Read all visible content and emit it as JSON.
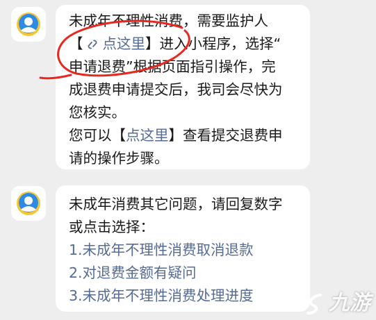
{
  "messages": [
    {
      "lines": {
        "l1": "未成年不理性消费，需要监护人",
        "l2_open": "【",
        "l2_link": "点这里",
        "l2_close": "】进入小程序，选择“",
        "l3": "申请退费”根据页面指引操作，完",
        "l4": "成退费申请提交后，我司会尽快为",
        "l5": "您核实。",
        "l6_before": "您可以【",
        "l6_link": "点这里",
        "l6_after": "】查看提交退费申",
        "l7": "请的操作步骤。"
      }
    },
    {
      "lines": {
        "l1": "未成年消费其它问题，请回复数字",
        "l2": "或点击选择："
      },
      "options": [
        "1.未成年不理性消费取消退款",
        "2.对退费金额有疑问",
        "3.未成年不理性消费处理进度"
      ]
    }
  ],
  "watermark": {
    "text": "九游"
  },
  "colors": {
    "link": "#566b94",
    "avatar_blue": "#2d8be6",
    "avatar_yellow": "#f7c531",
    "annotation_red": "#e8271f"
  }
}
